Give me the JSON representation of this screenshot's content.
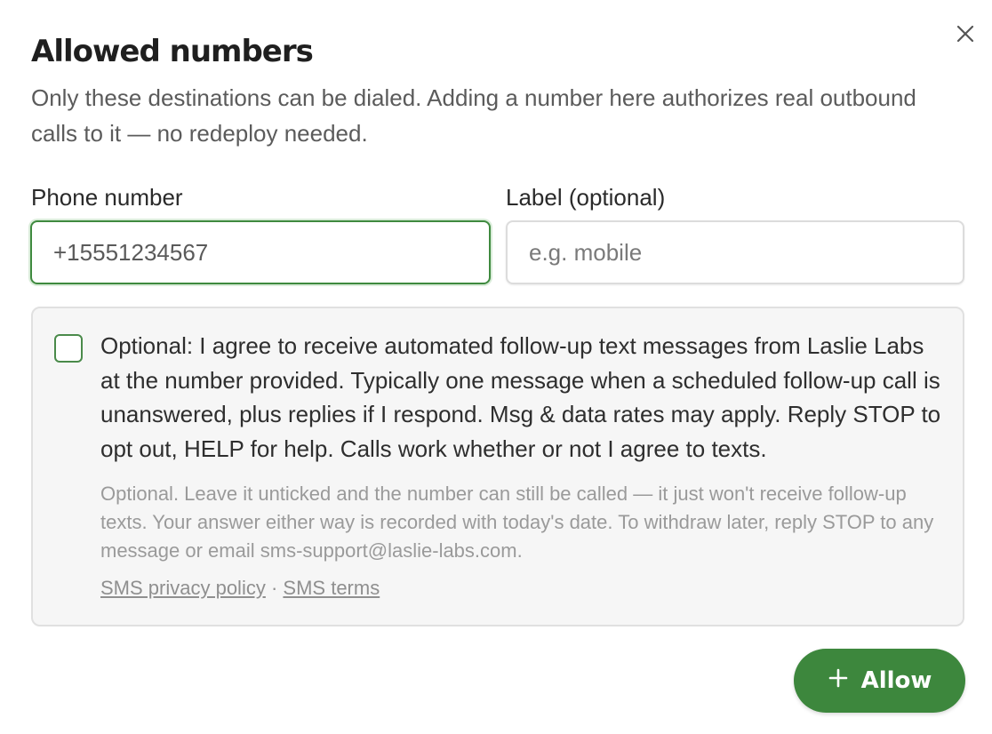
{
  "dialog": {
    "title": "Allowed numbers",
    "subtitle": "Only these destinations can be dialed. Adding a number here authorizes real outbound calls to it — no redeploy needed."
  },
  "form": {
    "phone_label": "Phone number",
    "phone_value": "+15551234567",
    "label_label": "Label (optional)",
    "label_placeholder": "e.g. mobile"
  },
  "consent": {
    "checked": false,
    "text": "Optional: I agree to receive automated follow-up text messages from Laslie Labs at the number provided. Typically one message when a scheduled follow-up call is unanswered, plus replies if I respond. Msg & data rates may apply. Reply STOP to opt out, HELP for help. Calls work whether or not I agree to texts.",
    "note": "Optional. Leave it unticked and the number can still be called — it just won't receive follow-up texts. Your answer either way is recorded with today's date. To withdraw later, reply STOP to any message or email sms-support@laslie-labs.com.",
    "privacy_link": "SMS privacy policy",
    "separator": "·",
    "terms_link": "SMS terms"
  },
  "actions": {
    "allow_label": "Allow",
    "allow_icon": "plus-icon",
    "close_icon": "close-icon"
  },
  "colors": {
    "accent": "#3d873d",
    "focus_border": "#3f8a3f"
  }
}
